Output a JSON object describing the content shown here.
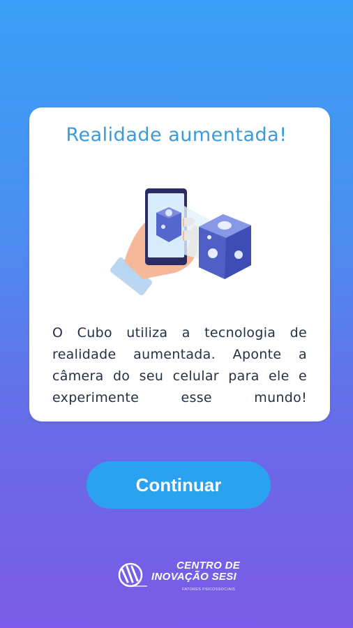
{
  "card": {
    "title": "Realidade aumentada!",
    "body": "O Cubo utiliza a tecnologia de realidade aumentada. Aponte a câmera do seu celular para ele e experimente esse mundo!"
  },
  "illustration": {
    "icon": "phone-ar-cube-illustration"
  },
  "continue_button": {
    "label": "Continuar"
  },
  "footer": {
    "logo_line1": "CENTRO DE",
    "logo_line2": "INOVAÇÃO SESI",
    "logo_sub": "FATORES PSICOSSOCIAIS"
  },
  "colors": {
    "background_top": "#3aa0f7",
    "background_bottom": "#7a5ae6",
    "title": "#3d9ad8",
    "button": "#2aa2f0",
    "text": "#263044"
  }
}
